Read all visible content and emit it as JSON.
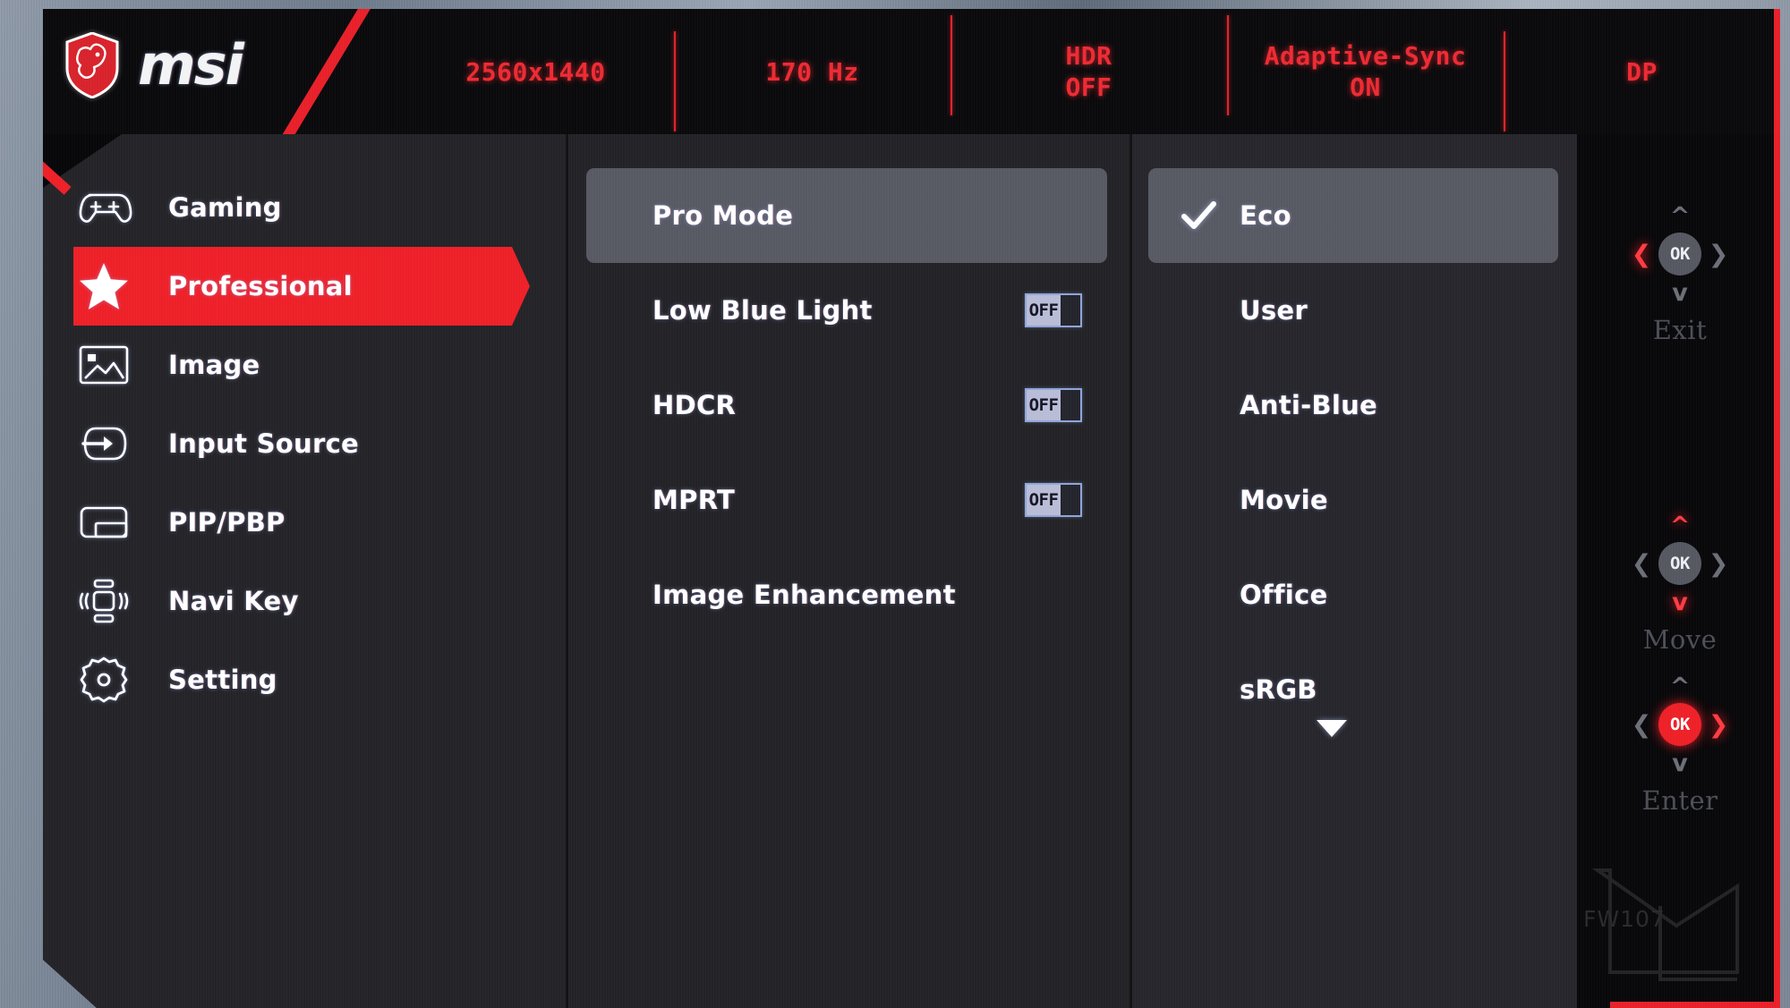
{
  "brand": {
    "name": "msi",
    "logo_icon": "msi-dragon-shield-icon"
  },
  "header": {
    "stats": [
      {
        "line1": "2560x1440",
        "line2": ""
      },
      {
        "line1": "170 Hz",
        "line2": ""
      },
      {
        "line1": "HDR",
        "line2": "OFF"
      },
      {
        "line1": "Adaptive-Sync",
        "line2": "ON"
      },
      {
        "line1": "DP",
        "line2": ""
      }
    ],
    "accent_color": "#ee2a33"
  },
  "sidebar": {
    "selected_index": 1,
    "highlight_color": "#ee2028",
    "items": [
      {
        "label": "Gaming",
        "icon": "gamepad-icon"
      },
      {
        "label": "Professional",
        "icon": "star-icon"
      },
      {
        "label": "Image",
        "icon": "picture-icon"
      },
      {
        "label": "Input Source",
        "icon": "input-arrow-icon"
      },
      {
        "label": "PIP/PBP",
        "icon": "pip-pbp-icon"
      },
      {
        "label": "Navi Key",
        "icon": "navi-key-icon"
      },
      {
        "label": "Setting",
        "icon": "gear-icon"
      }
    ]
  },
  "middle_column": {
    "selected_index": 0,
    "items": [
      {
        "label": "Pro Mode",
        "toggle": null,
        "selected": true
      },
      {
        "label": "Low Blue Light",
        "toggle": "OFF",
        "selected": false
      },
      {
        "label": "HDCR",
        "toggle": "OFF",
        "selected": false
      },
      {
        "label": "MPRT",
        "toggle": "OFF",
        "selected": false
      },
      {
        "label": "Image Enhancement",
        "toggle": null,
        "selected": false
      }
    ]
  },
  "right_column": {
    "selected_index": 0,
    "checked_index": 0,
    "check_icon": "checkmark-icon",
    "scroll_icon": "chevron-down-icon",
    "items": [
      {
        "label": "Eco"
      },
      {
        "label": "User"
      },
      {
        "label": "Anti-Blue"
      },
      {
        "label": "Movie"
      },
      {
        "label": "Office"
      },
      {
        "label": "sRGB"
      }
    ]
  },
  "nav_panel": {
    "ok_label": "OK",
    "widgets": [
      {
        "label": "Exit",
        "ok_hot": false,
        "up_hot": false,
        "down_hot": false,
        "left_hot": true,
        "right_hot": false
      },
      {
        "label": "Move",
        "ok_hot": false,
        "up_hot": true,
        "down_hot": true,
        "left_hot": false,
        "right_hot": false
      },
      {
        "label": "Enter",
        "ok_hot": true,
        "up_hot": false,
        "down_hot": false,
        "left_hot": false,
        "right_hot": true
      }
    ]
  },
  "watermark": {
    "firmware": "FW107"
  }
}
